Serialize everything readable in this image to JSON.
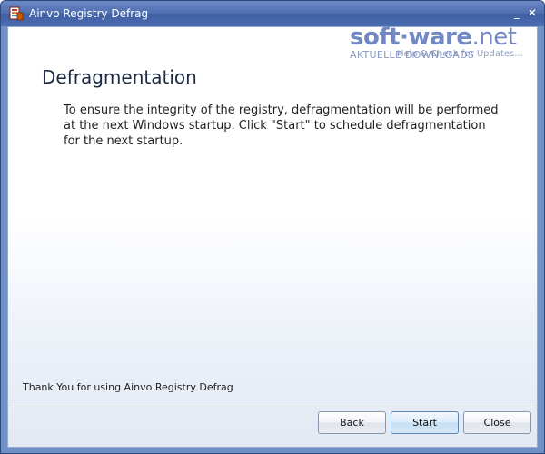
{
  "window": {
    "title": "Ainvo Registry Defrag",
    "minimize_glyph": "_",
    "close_glyph": "✕"
  },
  "watermark": {
    "logo_main": "soft·ware",
    "logo_tld": ".net",
    "tagline": "AKTUELLE DOWNLOADS",
    "help_text": "Help & Check for Updates..."
  },
  "page": {
    "heading": "Defragmentation",
    "description": "To ensure the integrity of the registry, defragmentation will be performed at the next Windows startup. Click \"Start\" to schedule defragmentation for the next startup.",
    "footer": "Thank You for using Ainvo Registry Defrag"
  },
  "buttons": {
    "back": "Back",
    "start": "Start",
    "close": "Close"
  },
  "icons": {
    "app": "registry-defrag-app-icon",
    "minimize": "minimize-icon",
    "close": "close-icon"
  },
  "colors": {
    "titlebar": "#4f6fb2",
    "accent": "#5a74b8",
    "heading": "#1e2a44"
  }
}
